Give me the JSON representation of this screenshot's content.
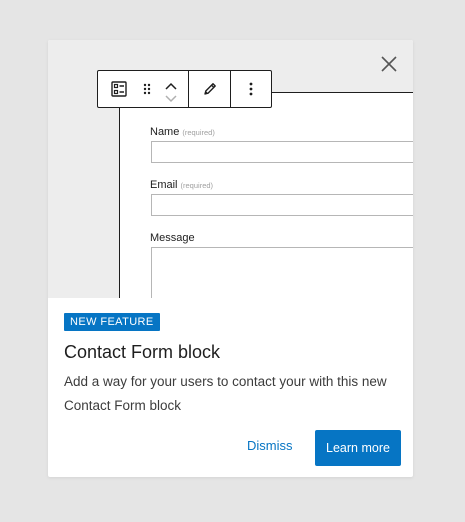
{
  "colors": {
    "page_background": "#e5e5e5",
    "card_background": "#ffffff",
    "preview_background": "#ededed",
    "accent": "#0675c4",
    "text": "#1e1e1e"
  },
  "preview": {
    "close_icon": "close-icon",
    "toolbar": {
      "icons": [
        "form-block-icon",
        "drag-handle-icon",
        "move-up-icon",
        "move-down-icon",
        "pencil-icon",
        "more-options-icon"
      ]
    },
    "form": {
      "fields": [
        {
          "label": "Name",
          "note": "(required)"
        },
        {
          "label": "Email",
          "note": "(required)"
        },
        {
          "label": "Message"
        }
      ]
    }
  },
  "guide": {
    "badge": "NEW FEATURE",
    "title": "Contact Form block",
    "description": "Add a way for your users to contact your with this new Contact Form block",
    "dismiss_label": "Dismiss",
    "learn_more_label": "Learn more"
  }
}
